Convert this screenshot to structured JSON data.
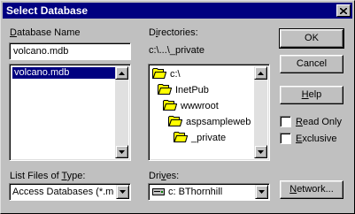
{
  "window": {
    "title": "Select Database"
  },
  "database_name": {
    "label_pre": "",
    "label_u": "D",
    "label_post": "atabase Name",
    "value": "volcano.mdb"
  },
  "file_list": {
    "items": [
      "volcano.mdb"
    ],
    "selected": "volcano.mdb"
  },
  "directories": {
    "label_pre": "D",
    "label_u": "i",
    "label_post": "rectories:",
    "current_path": "c:\\...\\_private",
    "tree": [
      {
        "name": "c:\\",
        "level": 0,
        "icon": "open-folder-icon"
      },
      {
        "name": "InetPub",
        "level": 1,
        "icon": "open-folder-icon"
      },
      {
        "name": "wwwroot",
        "level": 2,
        "icon": "open-folder-icon"
      },
      {
        "name": "aspsampleweb",
        "level": 3,
        "icon": "open-folder-icon"
      },
      {
        "name": "_private",
        "level": 4,
        "icon": "open-folder-icon"
      }
    ]
  },
  "list_files": {
    "label_pre": "List Files of ",
    "label_u": "T",
    "label_post": "ype:",
    "value": "Access Databases (*.mc"
  },
  "drives": {
    "label_pre": "Dri",
    "label_u": "v",
    "label_post": "es:",
    "value": "c: BThornhill",
    "icon": "drive-icon"
  },
  "buttons": {
    "ok": "OK",
    "cancel": "Cancel",
    "help_pre": "",
    "help_u": "H",
    "help_post": "elp",
    "network_pre": "",
    "network_u": "N",
    "network_post": "etwork..."
  },
  "checkboxes": {
    "read_only": {
      "pre": "",
      "u": "R",
      "post": "ead Only",
      "checked": false
    },
    "exclusive": {
      "pre": "",
      "u": "E",
      "post": "xclusive",
      "checked": false
    }
  },
  "colors": {
    "titlebar": "#000080",
    "face": "#c0c0c0",
    "selection": "#000080",
    "folder": "#ffff00"
  }
}
